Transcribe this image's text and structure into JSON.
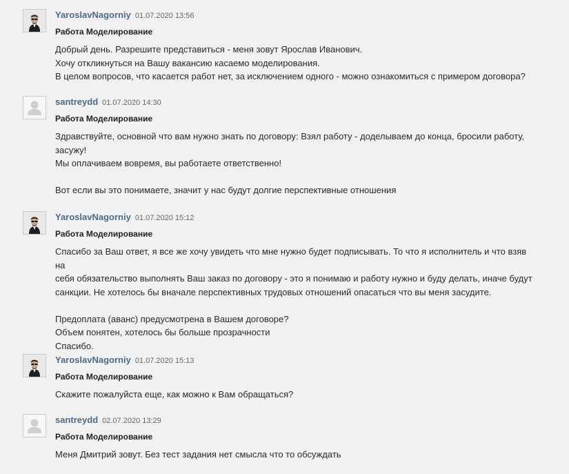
{
  "messages": [
    {
      "author": "YaroslavNagorniy",
      "date": "01.07.2020 13:56",
      "avatar": "photo-avatar",
      "subject": "Работа Моделирование",
      "lines": [
        "Добрый день. Разрешите представиться - меня зовут Ярослав Иванович.",
        "Хочу откликнуться на Вашу вакансию касаемо моделирования.",
        "В целом вопросов, что касается работ нет, за исключением одного - можно ознакомиться с примером договора?"
      ]
    },
    {
      "author": "santreydd",
      "date": "01.07.2020 14:30",
      "avatar": "default-user-icon",
      "subject": "Работа Моделирование",
      "lines": [
        "Здравствуйте, основной что вам нужно знать по договору: Взял работу - доделываем до конца, бросили работу,",
        "засужу!",
        "Мы оплачиваем вовремя, вы работаете ответственно!",
        "",
        "Вот если вы это понимаете, значит у нас будут долгие перспективные отношения"
      ]
    },
    {
      "author": "YaroslavNagorniy",
      "date": "01.07.2020 15:12",
      "avatar": "photo-avatar",
      "subject": "Работа Моделирование",
      "lines": [
        "Спасибо за Ваш ответ, я все же хочу увидеть что мне нужно будет подписывать. То что я исполнитель и что взяв на",
        "себя обязательство выполнять Ваш заказ по договору - это я понимаю и работу нужно и буду делать, иначе будут",
        "санкции. Не хотелось бы вначале перспективных трудовых отношений опасаться что вы меня засудите.",
        "",
        "Предоплата (аванс) предусмотрена в Вашем договоре?",
        "Объем понятен, хотелось бы больше прозрачности",
        "Спасибо."
      ]
    },
    {
      "author": "YaroslavNagorniy",
      "date": "01.07.2020 15:13",
      "avatar": "photo-avatar",
      "subject": "Работа Моделирование",
      "lines": [
        "Скажите пожалуйста еще, как можно к Вам обращаться?"
      ]
    },
    {
      "author": "santreydd",
      "date": "02.07.2020 13:29",
      "avatar": "default-user-icon",
      "subject": "Работа Моделирование",
      "lines": [
        "Меня Дмитрий зовут. Без тест задания нет смысла что то обсуждать"
      ]
    }
  ]
}
